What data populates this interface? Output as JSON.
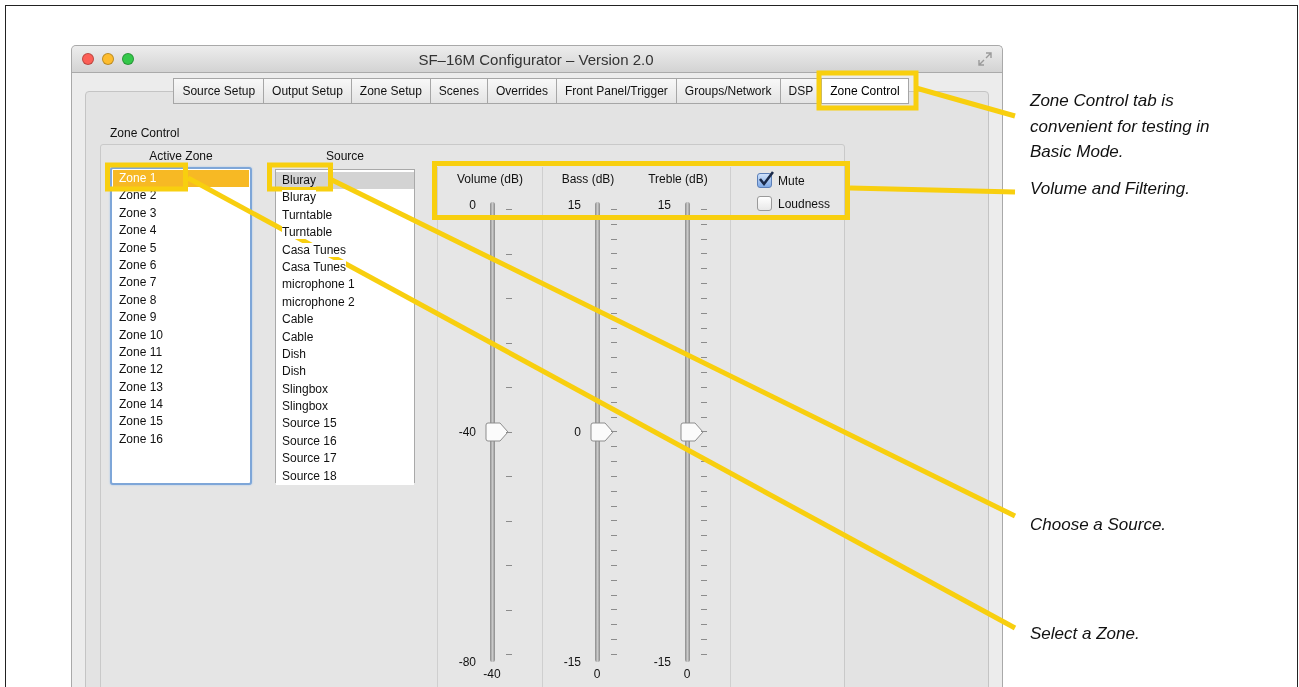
{
  "window": {
    "title": "SF–16M Configurator – Version 2.0"
  },
  "tabs": [
    {
      "label": "Source Setup",
      "selected": false
    },
    {
      "label": "Output Setup",
      "selected": false
    },
    {
      "label": "Zone Setup",
      "selected": false
    },
    {
      "label": "Scenes",
      "selected": false
    },
    {
      "label": "Overrides",
      "selected": false
    },
    {
      "label": "Front Panel/Trigger",
      "selected": false
    },
    {
      "label": "Groups/Network",
      "selected": false
    },
    {
      "label": "DSP",
      "selected": false
    },
    {
      "label": "Zone Control",
      "selected": true
    }
  ],
  "group_title": "Zone Control",
  "zones": {
    "heading": "Active Zone",
    "items": [
      {
        "label": "Zone 1",
        "selected": true
      },
      {
        "label": "Zone 2",
        "selected": false
      },
      {
        "label": "Zone 3",
        "selected": false
      },
      {
        "label": "Zone 4",
        "selected": false
      },
      {
        "label": "Zone 5",
        "selected": false
      },
      {
        "label": "Zone 6",
        "selected": false
      },
      {
        "label": "Zone 7",
        "selected": false
      },
      {
        "label": "Zone 8",
        "selected": false
      },
      {
        "label": "Zone 9",
        "selected": false
      },
      {
        "label": "Zone 10",
        "selected": false
      },
      {
        "label": "Zone 11",
        "selected": false
      },
      {
        "label": "Zone 12",
        "selected": false
      },
      {
        "label": "Zone 13",
        "selected": false
      },
      {
        "label": "Zone 14",
        "selected": false
      },
      {
        "label": "Zone 15",
        "selected": false
      },
      {
        "label": "Zone 16",
        "selected": false
      }
    ]
  },
  "sources": {
    "heading": "Source",
    "items": [
      {
        "label": "Bluray",
        "selected": true
      },
      {
        "label": "Bluray",
        "selected": false
      },
      {
        "label": "Turntable",
        "selected": false
      },
      {
        "label": "Turntable",
        "selected": false
      },
      {
        "label": "Casa Tunes",
        "selected": false
      },
      {
        "label": "Casa Tunes",
        "selected": false
      },
      {
        "label": "microphone 1",
        "selected": false
      },
      {
        "label": "microphone 2",
        "selected": false
      },
      {
        "label": "Cable",
        "selected": false
      },
      {
        "label": "Cable",
        "selected": false
      },
      {
        "label": "Dish",
        "selected": false
      },
      {
        "label": "Dish",
        "selected": false
      },
      {
        "label": "Slingbox",
        "selected": false
      },
      {
        "label": "Slingbox",
        "selected": false
      },
      {
        "label": "Source 15",
        "selected": false
      },
      {
        "label": "Source 16",
        "selected": false
      },
      {
        "label": "Source 17",
        "selected": false
      },
      {
        "label": "Source 18",
        "selected": false
      }
    ]
  },
  "sliders": [
    {
      "kind": "volume",
      "label": "Volume (dB)",
      "max_label": "0",
      "mid_label": "-40",
      "min_label": "-80",
      "reading": "-40",
      "level": 0.5
    },
    {
      "kind": "tone",
      "label": "Bass (dB)",
      "max_label": "15",
      "mid_label": "0",
      "min_label": "-15",
      "reading": "0",
      "level": 0.5
    },
    {
      "kind": "tone",
      "label": "Treble (dB)",
      "max_label": "15",
      "min_label": "-15",
      "reading": "0",
      "level": 0.5
    }
  ],
  "checkboxes": [
    {
      "label": "Mute",
      "checked": true
    },
    {
      "label": "Loudness",
      "checked": false
    }
  ],
  "annotations": [
    {
      "text": "Zone Control tab is convenient for testing in Basic Mode."
    },
    {
      "text": "Volume and Filtering."
    },
    {
      "text": "Choose a Source."
    },
    {
      "text": "Select a Zone."
    }
  ]
}
